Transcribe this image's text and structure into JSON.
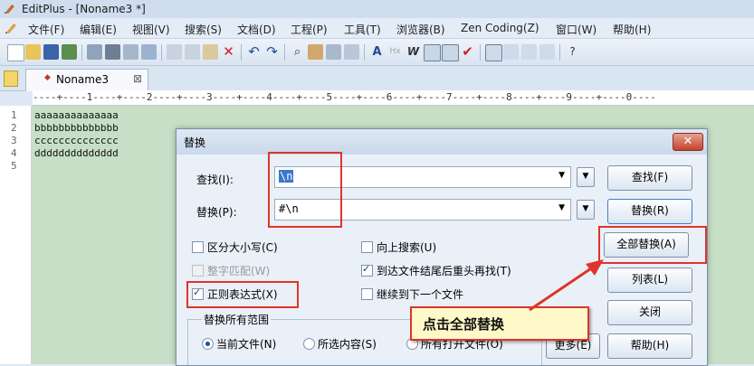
{
  "window": {
    "title": "EditPlus - [Noname3 *]"
  },
  "menu": [
    "文件(F)",
    "编辑(E)",
    "视图(V)",
    "搜索(S)",
    "文档(D)",
    "工程(P)",
    "工具(T)",
    "浏览器(B)",
    "Zen Coding(Z)",
    "窗口(W)",
    "帮助(H)"
  ],
  "tab": {
    "label": "Noname3",
    "close": "⊠"
  },
  "ruler": "----+----1----+----2----+----3----+----4----+----5----+----6----+----7----+----8----+----9----+----0----",
  "editor": {
    "line_numbers": [
      "1",
      "2",
      "3",
      "4",
      "5"
    ],
    "lines": [
      "aaaaaaaaaaaaaa",
      "bbbbbbbbbbbbbb",
      "cccccccccccccc",
      "dddddddddddddd"
    ]
  },
  "dialog": {
    "title": "替换",
    "close": "✕",
    "find_label": "查找(I):",
    "find_value": "\\n",
    "replace_label": "替换(P):",
    "replace_value": "#\\n",
    "options": {
      "match_case": "区分大小写(C)",
      "whole_word": "整字匹配(W)",
      "regex": "正则表达式(X)",
      "search_up": "向上搜索(U)",
      "wrap": "到达文件结尾后重头再找(T)",
      "next_file": "继续到下一个文件"
    },
    "scope": {
      "title": "替换所有范围",
      "current": "当前文件(N)",
      "selection": "所选内容(S)",
      "all_open": "所有打开文件(O)"
    },
    "buttons": {
      "find": "查找(F)",
      "replace": "替换(R)",
      "replace_all": "全部替换(A)",
      "list": "列表(L)",
      "close": "关闭",
      "more": "更多(E)",
      "help": "帮助(H)"
    }
  },
  "annotation": {
    "text": "点击全部替换"
  },
  "colors": {
    "highlight": "#e0332b",
    "editor_bg": "#c6dfc6",
    "note_bg": "#fff8c8"
  }
}
